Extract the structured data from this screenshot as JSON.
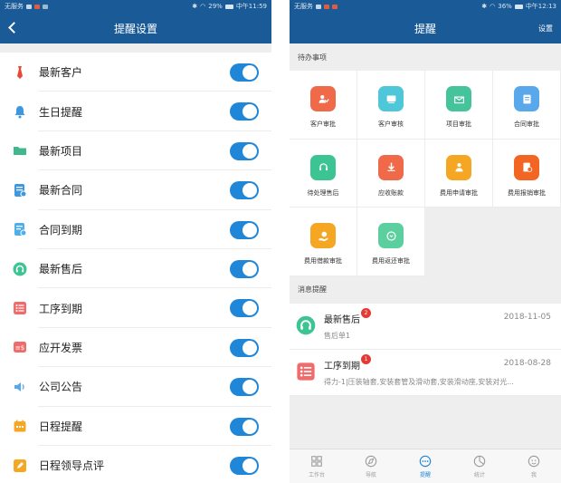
{
  "left": {
    "statusbar": {
      "carrier": "无服务",
      "battery": "29%",
      "time": "中午11:59"
    },
    "header": {
      "title": "提醒设置"
    },
    "settings": [
      {
        "label": "最新客户",
        "icon": "tie-icon",
        "enabled": true
      },
      {
        "label": "生日提醒",
        "icon": "bell-icon",
        "enabled": true
      },
      {
        "label": "最新项目",
        "icon": "folder-icon",
        "enabled": true
      },
      {
        "label": "最新合同",
        "icon": "contract-icon",
        "enabled": true
      },
      {
        "label": "合同到期",
        "icon": "contract-expiry-icon",
        "enabled": true
      },
      {
        "label": "最新售后",
        "icon": "headset-icon",
        "enabled": true
      },
      {
        "label": "工序到期",
        "icon": "list-icon",
        "enabled": true
      },
      {
        "label": "应开发票",
        "icon": "invoice-icon",
        "enabled": true
      },
      {
        "label": "公司公告",
        "icon": "speaker-icon",
        "enabled": true
      },
      {
        "label": "日程提醒",
        "icon": "calendar-icon",
        "enabled": true
      },
      {
        "label": "日程领导点评",
        "icon": "pen-icon",
        "enabled": true
      }
    ]
  },
  "right": {
    "statusbar": {
      "carrier": "无服务",
      "battery": "36%",
      "time": "中午12:13"
    },
    "header": {
      "title": "提醒",
      "action": "设置"
    },
    "todo": {
      "title": "待办事项",
      "items": [
        {
          "label": "客户审批",
          "icon": "customer-approve-icon",
          "color": "#f06a4a"
        },
        {
          "label": "客户审核",
          "icon": "customer-review-icon",
          "color": "#4ec7d8"
        },
        {
          "label": "项目审批",
          "icon": "project-approve-icon",
          "color": "#45c39a"
        },
        {
          "label": "合同审批",
          "icon": "contract-approve-icon",
          "color": "#5aa8ec"
        },
        {
          "label": "待处理售后",
          "icon": "service-icon",
          "color": "#3cc493"
        },
        {
          "label": "应收账款",
          "icon": "receivable-icon",
          "color": "#f06a4a"
        },
        {
          "label": "费用申请审批",
          "icon": "expense-apply-icon",
          "color": "#f5a623"
        },
        {
          "label": "费用报销审批",
          "icon": "reimburse-icon",
          "color": "#f26522"
        },
        {
          "label": "费用借款审批",
          "icon": "loan-icon",
          "color": "#f5a623"
        },
        {
          "label": "费用返还审批",
          "icon": "refund-icon",
          "color": "#5ccf9f"
        }
      ]
    },
    "messages": {
      "title": "消息提醒",
      "items": [
        {
          "title": "最新售后",
          "badge": "2",
          "date": "2018-11-05",
          "subtitle": "售后单1",
          "icon": "headset-icon",
          "color": "#3cc493"
        },
        {
          "title": "工序到期",
          "badge": "1",
          "date": "2018-08-28",
          "subtitle": "得力-1|压装轴套,安装套管及滑动套,安装滑动座,安装对光...",
          "icon": "list-icon",
          "color": "#f26b6b"
        }
      ]
    },
    "tabs": [
      {
        "label": "工作台",
        "icon": "workbench-icon",
        "active": false
      },
      {
        "label": "导航",
        "icon": "navigation-icon",
        "active": false
      },
      {
        "label": "提醒",
        "icon": "chat-icon",
        "active": true
      },
      {
        "label": "统计",
        "icon": "pie-icon",
        "active": false
      },
      {
        "label": "我",
        "icon": "user-icon",
        "active": false
      }
    ],
    "colors": {
      "brand": "#1a5a96",
      "accent": "#1f86d8"
    }
  }
}
